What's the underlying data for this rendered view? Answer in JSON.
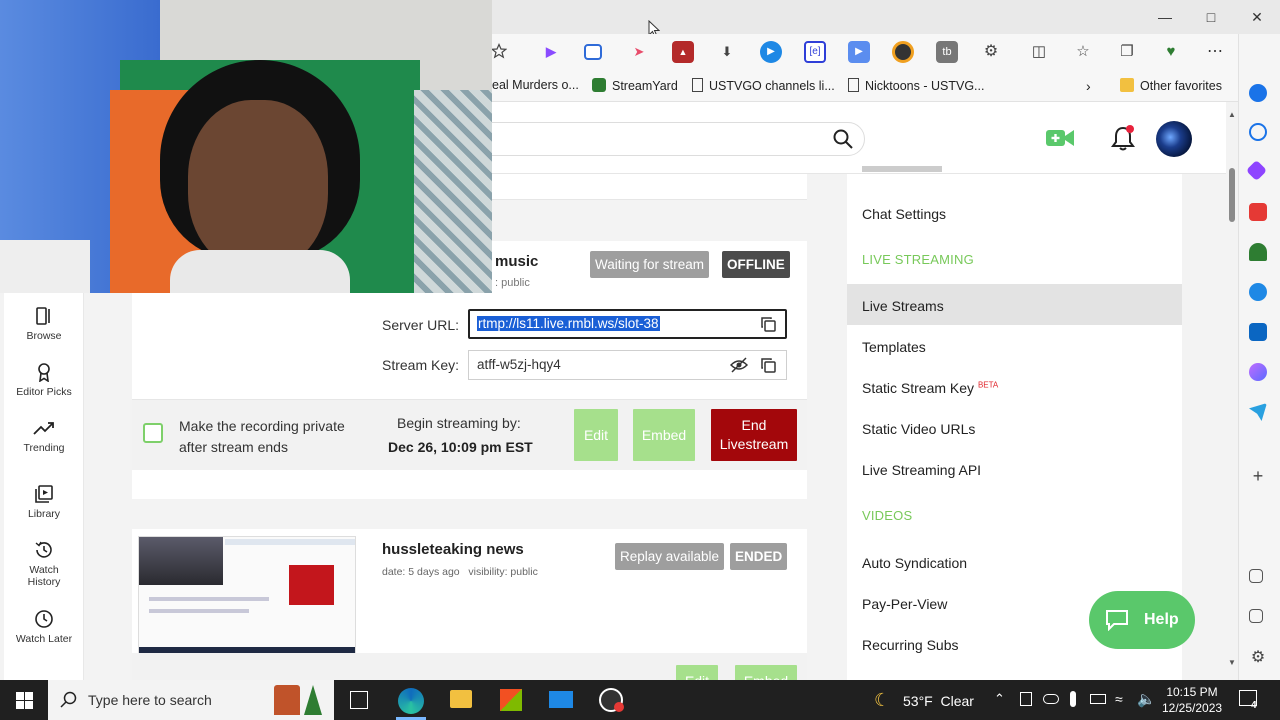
{
  "browser": {
    "favorites": [
      "eal Murders o...",
      "StreamYard",
      "USTVGO channels li...",
      "Nicktoons - USTVG...",
      "Other favorites"
    ]
  },
  "nav": [
    {
      "label": "Browse",
      "icon": "browse-icon"
    },
    {
      "label": "Editor Picks",
      "icon": "ribbon-icon"
    },
    {
      "label": "Trending",
      "icon": "trending-icon"
    },
    {
      "label": "Library",
      "icon": "library-icon"
    },
    {
      "label": "Watch History",
      "icon": "history-icon"
    },
    {
      "label": "Watch Later",
      "icon": "clock-icon"
    }
  ],
  "stream": {
    "title_fragment": "music",
    "visibility_fragment": ": public",
    "status_waiting": "Waiting for stream",
    "status_offline": "OFFLINE",
    "server_url_label": "Server URL:",
    "server_url_value": "rtmp://ls11.live.rmbl.ws/slot-38",
    "stream_key_label": "Stream Key:",
    "stream_key_value": "atff-w5zj-hqy4",
    "private_line1": "Make the recording private",
    "private_line2": "after stream ends",
    "begin_label": "Begin streaming by:",
    "begin_date": "Dec 26, 10:09 pm EST",
    "edit": "Edit",
    "embed": "Embed",
    "end_line1": "End",
    "end_line2": "Livestream"
  },
  "past_stream": {
    "title": "hussleteaking news",
    "meta": "date: 5 days ago   visibility: public",
    "status_replay": "Replay available",
    "status_ended": "ENDED",
    "edit": "Edit",
    "embed": "Embed"
  },
  "side_menu": {
    "chat_settings": "Chat Settings",
    "live_streaming_head": "LIVE STREAMING",
    "live_streams": "Live Streams",
    "templates": "Templates",
    "static_stream_key": "Static Stream Key",
    "beta": "BETA",
    "static_video_urls": "Static Video URLs",
    "live_streaming_api": "Live Streaming API",
    "videos_head": "VIDEOS",
    "auto_syndication": "Auto Syndication",
    "pay_per_view": "Pay-Per-View",
    "recurring_subs": "Recurring Subs"
  },
  "help": "Help",
  "taskbar": {
    "search_placeholder": "Type here to search",
    "weather": "53°F  Clear",
    "time": "10:15 PM",
    "date": "12/25/2023",
    "notif_count": "4"
  },
  "colors": {
    "accent_green": "#78c95a",
    "button_green": "#a6e08c",
    "end_red": "#a3070b",
    "badge_gray": "#9e9e9e",
    "badge_dark": "#4b4b4b"
  }
}
